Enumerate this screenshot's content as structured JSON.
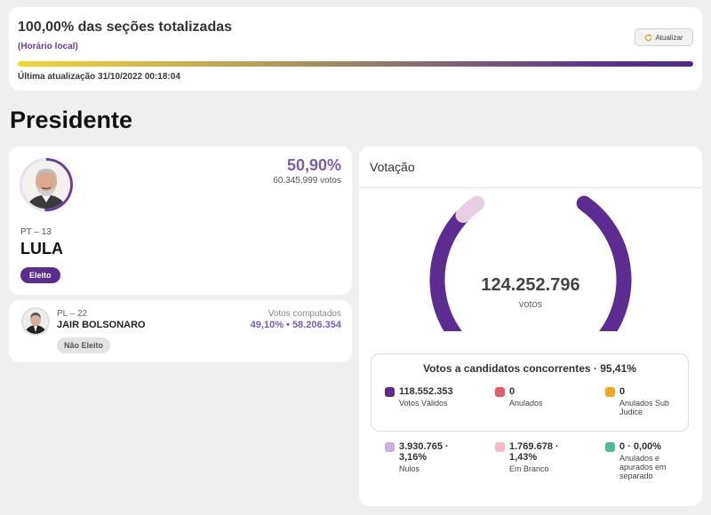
{
  "status": {
    "title": "100,00% das seções totalizadas",
    "local_time": "(Horário local)",
    "update_button": "Atualizar",
    "last_update": "Última atualização 31/10/2022 00:18:04",
    "progress_fraction": 1.0
  },
  "section_title": "Presidente",
  "candidates": [
    {
      "party": "PT – 13",
      "name": "LULA",
      "percent": "50,90%",
      "votes": "60.345.999 votos",
      "badge": "Eleito"
    },
    {
      "party": "PL – 22",
      "name": "JAIR BOLSONARO",
      "computed_label": "Votos computados",
      "result": "49,10%  •  58.206.354",
      "badge": "Não Eleito"
    }
  ],
  "votacao": {
    "title": "Votação",
    "total": "124.252.796",
    "total_label": "votos",
    "gauge_fraction_valid": 0.9541,
    "concorrentes_title": "Votos a candidatos concorrentes · 95,41%",
    "stats_row1": [
      {
        "value": "118.552.353",
        "label": "Votos Válidos",
        "color": "#5b2d90"
      },
      {
        "value": "0",
        "label": "Anulados",
        "color": "#e45b6b"
      },
      {
        "value": "0",
        "label": "Anulados Sub Judice",
        "color": "#f0a81c"
      }
    ],
    "stats_row2": [
      {
        "value": "3.930.765 · 3,16%",
        "label": "Nulos",
        "color": "#c8b2d8"
      },
      {
        "value": "1.769.678 · 1,43%",
        "label": "Em Branco",
        "color": "#f5bcc6"
      },
      {
        "value": "0 · 0,00%",
        "label": "Anulados e apurados em separado",
        "color": "#4cbd97"
      }
    ]
  },
  "colors": {
    "accent": "#5b2d90",
    "percent_text": "#7a5ea8",
    "background": "#f0f0f0"
  }
}
